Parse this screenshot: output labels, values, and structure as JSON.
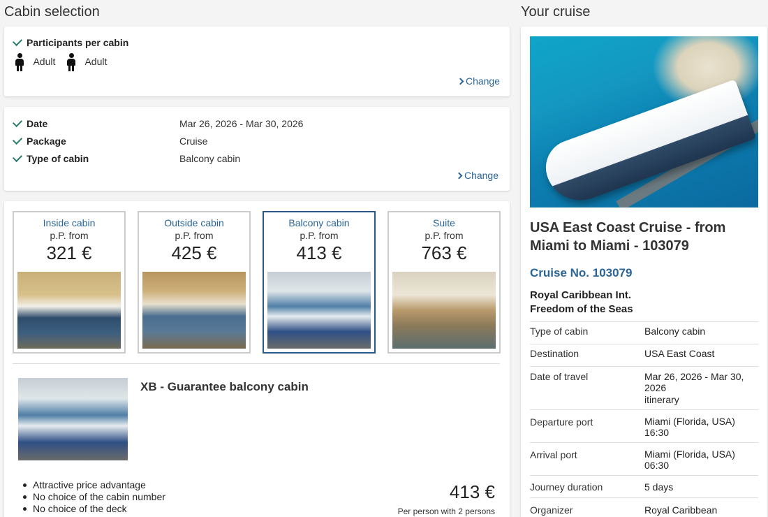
{
  "left_title": "Cabin selection",
  "right_title": "Your cruise",
  "participants": {
    "label": "Participants per cabin",
    "persons": [
      "Adult",
      "Adult"
    ],
    "change": "Change"
  },
  "summary": {
    "rows": [
      {
        "label": "Date",
        "value": "Mar 26, 2026 - Mar 30, 2026"
      },
      {
        "label": "Package",
        "value": "Cruise"
      },
      {
        "label": "Type of cabin",
        "value": "Balcony cabin"
      }
    ],
    "change": "Change"
  },
  "cabins": [
    {
      "name": "Inside cabin",
      "from": "p.P. from",
      "price": "321 €",
      "selected": false
    },
    {
      "name": "Outside cabin",
      "from": "p.P. from",
      "price": "425 €",
      "selected": false
    },
    {
      "name": "Balcony cabin",
      "from": "p.P. from",
      "price": "413 €",
      "selected": true
    },
    {
      "name": "Suite",
      "from": "p.P. from",
      "price": "763 €",
      "selected": false
    }
  ],
  "offer": {
    "title": "XB - Guarantee balcony cabin",
    "bullets": [
      "Attractive price advantage",
      "No choice of the cabin number",
      "No choice of the deck"
    ],
    "price": "413 €",
    "price_note": "Per person with 2 persons"
  },
  "cruise": {
    "heading": "USA East Coast Cruise - from Miami to Miami - 103079",
    "number": "Cruise No. 103079",
    "company": "Royal Caribbean Int.",
    "ship": "Freedom of the Seas",
    "details": [
      {
        "label": "Type of cabin",
        "value": "Balcony cabin"
      },
      {
        "label": "Destination",
        "value": "USA East Coast"
      },
      {
        "label": "Date of travel",
        "value": "Mar 26, 2026 - Mar 30, 2026",
        "link": "itinerary"
      },
      {
        "label": "Departure port",
        "value": "Miami (Florida, USA)",
        "value2": "16:30"
      },
      {
        "label": "Arrival port",
        "value": "Miami (Florida, USA)",
        "value2": "06:30"
      },
      {
        "label": "Journey duration",
        "value": "5 days"
      },
      {
        "label": "Organizer",
        "value": "Royal Caribbean"
      }
    ]
  }
}
